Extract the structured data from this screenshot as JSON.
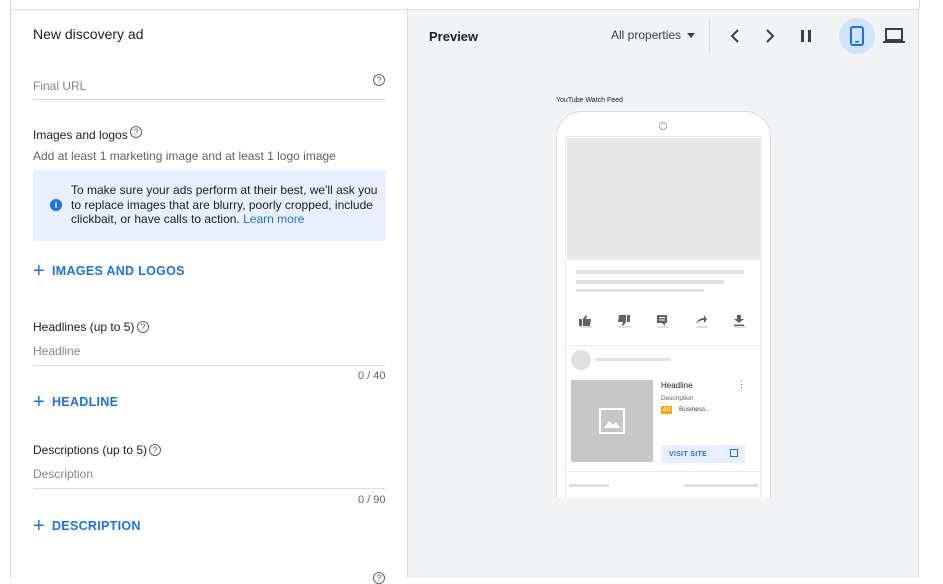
{
  "left": {
    "title": "New discovery ad",
    "final_url_placeholder": "Final URL",
    "images": {
      "label": "Images and logos",
      "hint": "Add at least 1 marketing image and at least 1 logo image",
      "info_text": "To make sure your ads perform at their best, we'll ask you to replace images that are blurry, poorly cropped, include clickbait, or have calls to action.",
      "info_link": "Learn more",
      "add_label": "IMAGES AND LOGOS"
    },
    "headlines": {
      "label": "Headlines (up to 5)",
      "placeholder": "Headline",
      "counter": "0 / 40",
      "add_label": "HEADLINE"
    },
    "descriptions": {
      "label": "Descriptions (up to 5)",
      "placeholder": "Description",
      "counter": "0 / 90",
      "add_label": "DESCRIPTION"
    }
  },
  "preview": {
    "title": "Preview",
    "properties_select": "All properties",
    "feed_label": "YouTube Watch Feed",
    "ad": {
      "headline": "Headline",
      "description": "Description",
      "badge": "Ad",
      "business": "Business..",
      "cta": "VISIT SITE"
    }
  },
  "icons": {
    "help": "question-circle-icon",
    "info": "info-icon",
    "prev": "chevron-left-icon",
    "next": "chevron-right-icon",
    "pause": "pause-icon",
    "mobile": "smartphone-icon",
    "desktop": "laptop-icon"
  },
  "colors": {
    "accent": "#1a73e8",
    "info_bg": "#e8f0fe",
    "preview_bg": "#f1f3f4",
    "ad_badge": "#f9ab00"
  }
}
